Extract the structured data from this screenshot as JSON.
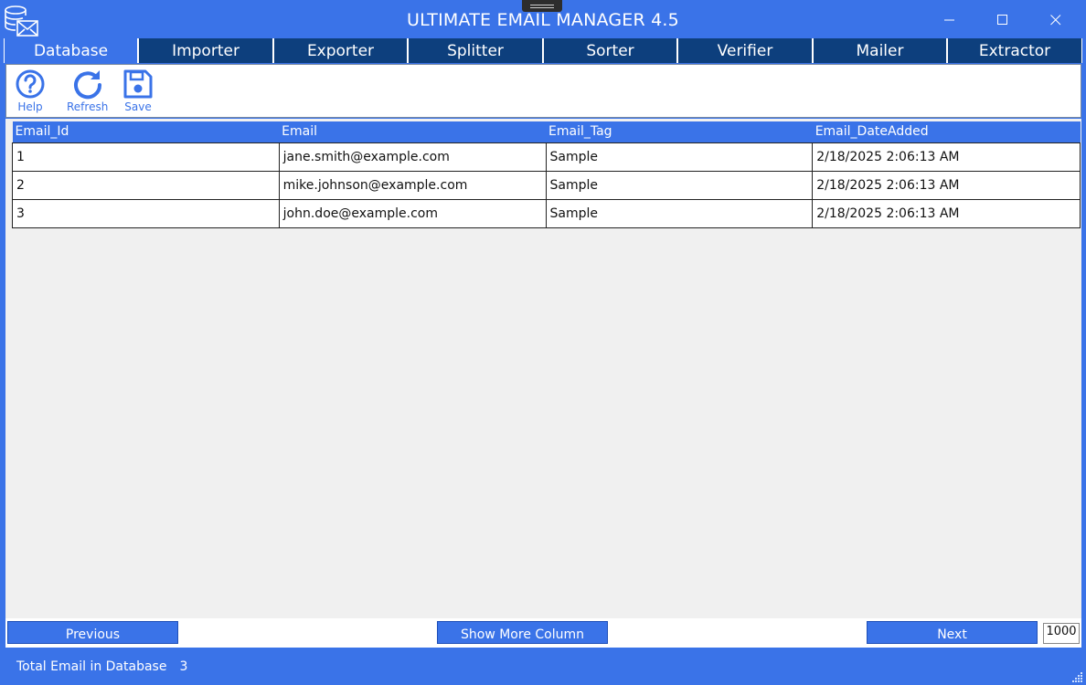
{
  "window": {
    "title": "ULTIMATE EMAIL MANAGER 4.5",
    "app_icon": "database-mail-icon"
  },
  "tabs": [
    {
      "label": "Database",
      "active": true
    },
    {
      "label": "Importer",
      "active": false
    },
    {
      "label": "Exporter",
      "active": false
    },
    {
      "label": "Splitter",
      "active": false
    },
    {
      "label": "Sorter",
      "active": false
    },
    {
      "label": "Verifier",
      "active": false
    },
    {
      "label": "Mailer",
      "active": false
    },
    {
      "label": "Extractor",
      "active": false
    }
  ],
  "toolbar": {
    "help_label": "Help",
    "refresh_label": "Refresh",
    "save_label": "Save"
  },
  "table": {
    "columns": [
      "Email_Id",
      "Email",
      "Email_Tag",
      "Email_DateAdded"
    ],
    "rows": [
      [
        "1",
        "jane.smith@example.com",
        "Sample",
        "2/18/2025 2:06:13 AM"
      ],
      [
        "2",
        "mike.johnson@example.com",
        "Sample",
        "2/18/2025 2:06:13 AM"
      ],
      [
        "3",
        "john.doe@example.com",
        "Sample",
        "2/18/2025 2:06:13 AM"
      ]
    ]
  },
  "footer": {
    "previous_label": "Previous",
    "show_more_label": "Show More Column",
    "next_label": "Next",
    "page_size": "1000"
  },
  "status": {
    "label": "Total Email in Database",
    "count": "3"
  },
  "colors": {
    "accent": "#3a73e8",
    "tab_dark": "#0d3f7d",
    "content_bg": "#f0f0f0"
  }
}
